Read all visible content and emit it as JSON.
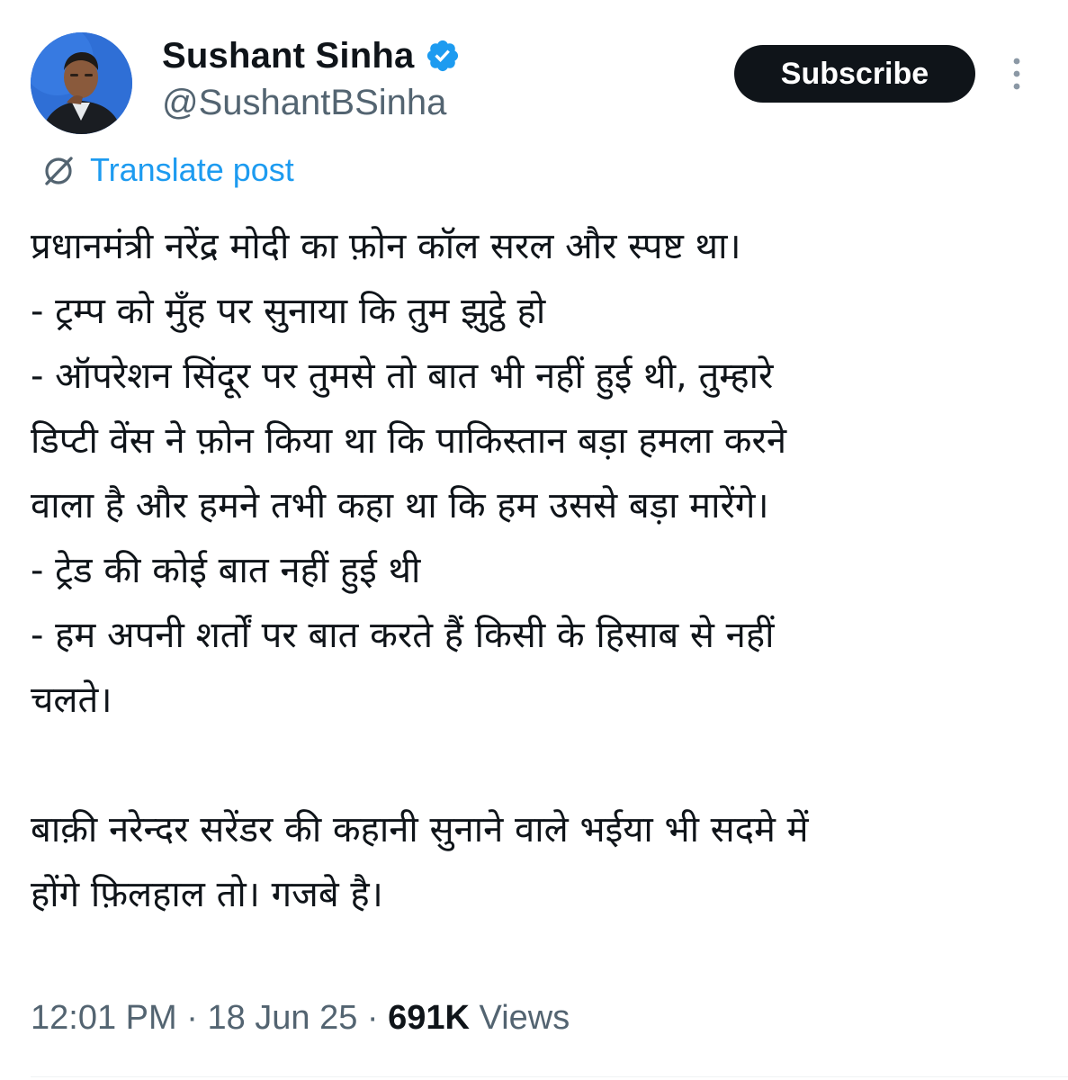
{
  "author": {
    "display_name": "Sushant Sinha",
    "handle": "@SushantBSinha",
    "verified_color": "#1d9bf0",
    "avatar_bg": "#2f6fd6"
  },
  "actions": {
    "subscribe_label": "Subscribe",
    "more_icon": "more-vertical-icon"
  },
  "translate": {
    "icon": "translate-icon",
    "label": "Translate post"
  },
  "post": {
    "lines": [
      "प्रधानमंत्री नरेंद्र मोदी का फ़ोन कॉल सरल और स्पष्ट था।",
      "- ट्रम्प को मुँह पर सुनाया कि तुम झुट्ठे हो",
      "- ऑपरेशन सिंदूर पर तुमसे तो बात भी नहीं हुई थी, तुम्हारे",
      "डिप्टी वेंस ने फ़ोन किया था कि पाकिस्तान बड़ा हमला करने",
      "वाला है और हमने तभी कहा था कि हम उससे बड़ा मारेंगे।",
      "- ट्रेड की कोई बात नहीं हुई थी",
      "- हम अपनी शर्तों पर बात करते हैं किसी के हिसाब से नहीं",
      "चलते।",
      "",
      "बाक़ी नरेन्दर सरेंडर की कहानी सुनाने वाले भईया भी सदमे में",
      "होंगे फ़िलहाल तो। गजबे है।"
    ]
  },
  "meta": {
    "time": "12:01 PM",
    "separator": "·",
    "date": "18 Jun 25",
    "views_count": "691K",
    "views_label": "Views"
  }
}
